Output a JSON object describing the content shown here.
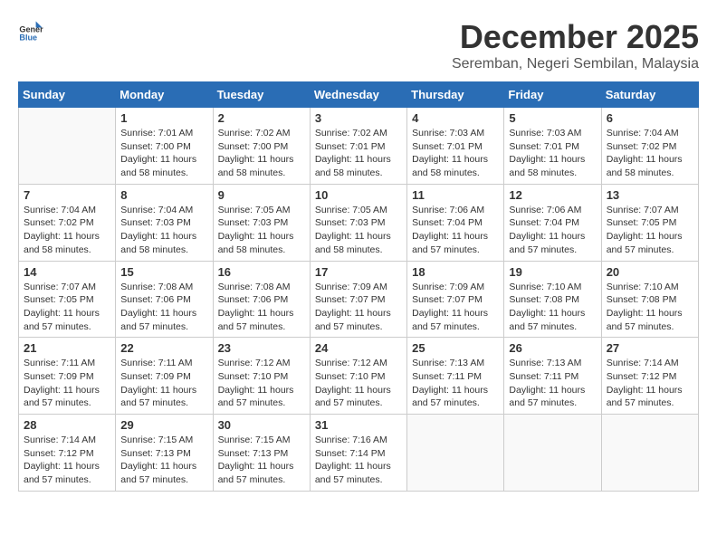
{
  "logo": {
    "line1": "General",
    "line2": "Blue"
  },
  "title": "December 2025",
  "location": "Seremban, Negeri Sembilan, Malaysia",
  "weekdays": [
    "Sunday",
    "Monday",
    "Tuesday",
    "Wednesday",
    "Thursday",
    "Friday",
    "Saturday"
  ],
  "weeks": [
    [
      {
        "day": "",
        "empty": true
      },
      {
        "day": "1",
        "sunrise": "7:01 AM",
        "sunset": "7:00 PM",
        "daylight": "11 hours and 58 minutes."
      },
      {
        "day": "2",
        "sunrise": "7:02 AM",
        "sunset": "7:00 PM",
        "daylight": "11 hours and 58 minutes."
      },
      {
        "day": "3",
        "sunrise": "7:02 AM",
        "sunset": "7:01 PM",
        "daylight": "11 hours and 58 minutes."
      },
      {
        "day": "4",
        "sunrise": "7:03 AM",
        "sunset": "7:01 PM",
        "daylight": "11 hours and 58 minutes."
      },
      {
        "day": "5",
        "sunrise": "7:03 AM",
        "sunset": "7:01 PM",
        "daylight": "11 hours and 58 minutes."
      },
      {
        "day": "6",
        "sunrise": "7:04 AM",
        "sunset": "7:02 PM",
        "daylight": "11 hours and 58 minutes."
      }
    ],
    [
      {
        "day": "7",
        "sunrise": "7:04 AM",
        "sunset": "7:02 PM",
        "daylight": "11 hours and 58 minutes."
      },
      {
        "day": "8",
        "sunrise": "7:04 AM",
        "sunset": "7:03 PM",
        "daylight": "11 hours and 58 minutes."
      },
      {
        "day": "9",
        "sunrise": "7:05 AM",
        "sunset": "7:03 PM",
        "daylight": "11 hours and 58 minutes."
      },
      {
        "day": "10",
        "sunrise": "7:05 AM",
        "sunset": "7:03 PM",
        "daylight": "11 hours and 58 minutes."
      },
      {
        "day": "11",
        "sunrise": "7:06 AM",
        "sunset": "7:04 PM",
        "daylight": "11 hours and 57 minutes."
      },
      {
        "day": "12",
        "sunrise": "7:06 AM",
        "sunset": "7:04 PM",
        "daylight": "11 hours and 57 minutes."
      },
      {
        "day": "13",
        "sunrise": "7:07 AM",
        "sunset": "7:05 PM",
        "daylight": "11 hours and 57 minutes."
      }
    ],
    [
      {
        "day": "14",
        "sunrise": "7:07 AM",
        "sunset": "7:05 PM",
        "daylight": "11 hours and 57 minutes."
      },
      {
        "day": "15",
        "sunrise": "7:08 AM",
        "sunset": "7:06 PM",
        "daylight": "11 hours and 57 minutes."
      },
      {
        "day": "16",
        "sunrise": "7:08 AM",
        "sunset": "7:06 PM",
        "daylight": "11 hours and 57 minutes."
      },
      {
        "day": "17",
        "sunrise": "7:09 AM",
        "sunset": "7:07 PM",
        "daylight": "11 hours and 57 minutes."
      },
      {
        "day": "18",
        "sunrise": "7:09 AM",
        "sunset": "7:07 PM",
        "daylight": "11 hours and 57 minutes."
      },
      {
        "day": "19",
        "sunrise": "7:10 AM",
        "sunset": "7:08 PM",
        "daylight": "11 hours and 57 minutes."
      },
      {
        "day": "20",
        "sunrise": "7:10 AM",
        "sunset": "7:08 PM",
        "daylight": "11 hours and 57 minutes."
      }
    ],
    [
      {
        "day": "21",
        "sunrise": "7:11 AM",
        "sunset": "7:09 PM",
        "daylight": "11 hours and 57 minutes."
      },
      {
        "day": "22",
        "sunrise": "7:11 AM",
        "sunset": "7:09 PM",
        "daylight": "11 hours and 57 minutes."
      },
      {
        "day": "23",
        "sunrise": "7:12 AM",
        "sunset": "7:10 PM",
        "daylight": "11 hours and 57 minutes."
      },
      {
        "day": "24",
        "sunrise": "7:12 AM",
        "sunset": "7:10 PM",
        "daylight": "11 hours and 57 minutes."
      },
      {
        "day": "25",
        "sunrise": "7:13 AM",
        "sunset": "7:11 PM",
        "daylight": "11 hours and 57 minutes."
      },
      {
        "day": "26",
        "sunrise": "7:13 AM",
        "sunset": "7:11 PM",
        "daylight": "11 hours and 57 minutes."
      },
      {
        "day": "27",
        "sunrise": "7:14 AM",
        "sunset": "7:12 PM",
        "daylight": "11 hours and 57 minutes."
      }
    ],
    [
      {
        "day": "28",
        "sunrise": "7:14 AM",
        "sunset": "7:12 PM",
        "daylight": "11 hours and 57 minutes."
      },
      {
        "day": "29",
        "sunrise": "7:15 AM",
        "sunset": "7:13 PM",
        "daylight": "11 hours and 57 minutes."
      },
      {
        "day": "30",
        "sunrise": "7:15 AM",
        "sunset": "7:13 PM",
        "daylight": "11 hours and 57 minutes."
      },
      {
        "day": "31",
        "sunrise": "7:16 AM",
        "sunset": "7:14 PM",
        "daylight": "11 hours and 57 minutes."
      },
      {
        "day": "",
        "empty": true
      },
      {
        "day": "",
        "empty": true
      },
      {
        "day": "",
        "empty": true
      }
    ]
  ]
}
